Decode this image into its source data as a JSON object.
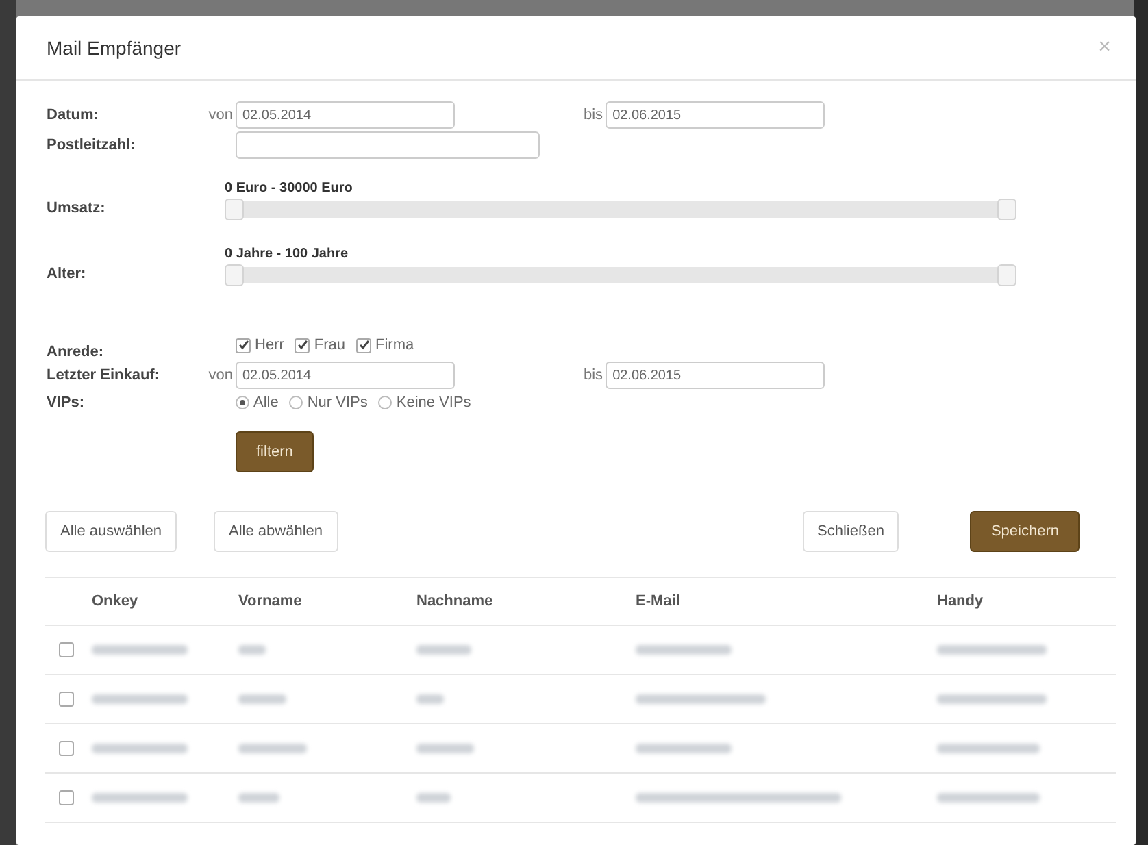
{
  "dialog": {
    "title": "Mail Empfänger",
    "close": "×"
  },
  "date": {
    "label": "Datum:",
    "from_label": "von",
    "from": "02.05.2014",
    "to_label": "bis",
    "to": "02.06.2015"
  },
  "postcode": {
    "label": "Postleitzahl:"
  },
  "sliders": [
    {
      "label": "Umsatz:",
      "range": "0 Euro - 30000 Euro",
      "thumbs": [
        {
          "level": 0
        },
        {
          "level": 1
        }
      ]
    },
    {
      "label": "Alter:",
      "range": "0 Jahre - 100 Jahre",
      "thumbs": [
        {
          "level": 0
        },
        {
          "level": 1
        }
      ]
    }
  ],
  "salutation": {
    "label": "Anrede:",
    "options": [
      {
        "label": "Herr",
        "checked": true
      },
      {
        "label": "Frau",
        "checked": true
      },
      {
        "label": "Firma",
        "checked": true
      }
    ]
  },
  "last_purchase": {
    "label": "Letzter Einkauf:",
    "from_label": "von",
    "from": "02.05.2014",
    "to_label": "bis",
    "to": "02.06.2015"
  },
  "vips": {
    "label": "VIPs:",
    "options": [
      {
        "label": "Alle",
        "selected": true
      },
      {
        "label": "Nur VIPs",
        "selected": false
      },
      {
        "label": "Keine VIPs",
        "selected": false
      }
    ]
  },
  "filter_button": "filtern",
  "actions": {
    "select_all": "Alle auswählen",
    "deselect_all": "Alle abwählen",
    "close": "Schließen",
    "save": "Speichern"
  },
  "table": {
    "columns": [
      "Onkey",
      "Vorname",
      "Nachname",
      "E-Mail",
      "Handy"
    ],
    "rows": [
      {
        "checked": false
      },
      {
        "checked": false
      },
      {
        "checked": false
      },
      {
        "checked": false
      }
    ]
  }
}
